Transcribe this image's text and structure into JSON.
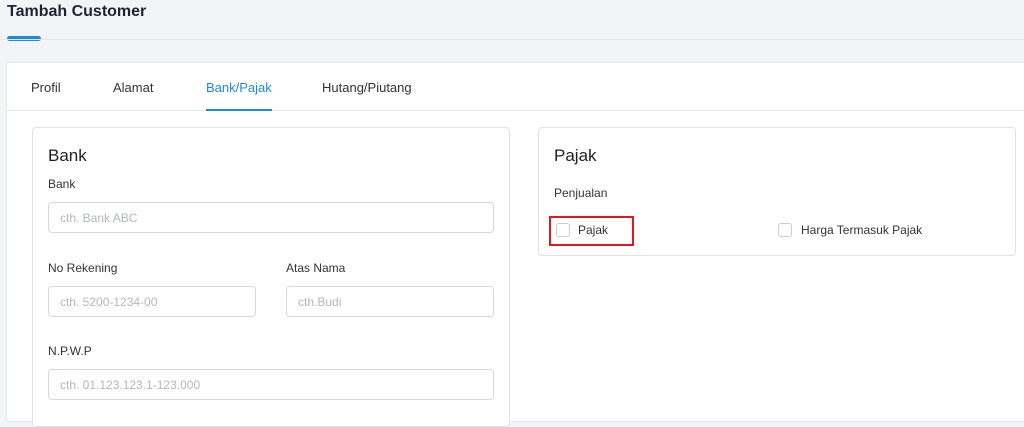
{
  "page": {
    "title": "Tambah Customer"
  },
  "tabs": [
    {
      "label": "Profil",
      "active": false
    },
    {
      "label": "Alamat",
      "active": false
    },
    {
      "label": "Bank/Pajak",
      "active": true
    },
    {
      "label": "Hutang/Piutang",
      "active": false
    }
  ],
  "bank_panel": {
    "title": "Bank",
    "bank": {
      "label": "Bank",
      "placeholder": "cth. Bank ABC",
      "value": ""
    },
    "account_number": {
      "label": "No Rekening",
      "placeholder": "cth. 5200-1234-00",
      "value": ""
    },
    "account_name": {
      "label": "Atas Nama",
      "placeholder": "cth.Budi",
      "value": ""
    },
    "npwp": {
      "label": "N.P.W.P",
      "placeholder": "cth. 01.123.123.1-123.000",
      "value": ""
    }
  },
  "tax_panel": {
    "title": "Pajak",
    "section_label": "Penjualan",
    "tax_checkbox": {
      "label": "Pajak",
      "checked": false,
      "highlighted": true
    },
    "price_includes_tax_checkbox": {
      "label": "Harga Termasuk Pajak",
      "checked": false
    }
  },
  "colors": {
    "accent": "#1e88e5",
    "highlight": "#e0191e",
    "background": "#f3f4f7"
  }
}
